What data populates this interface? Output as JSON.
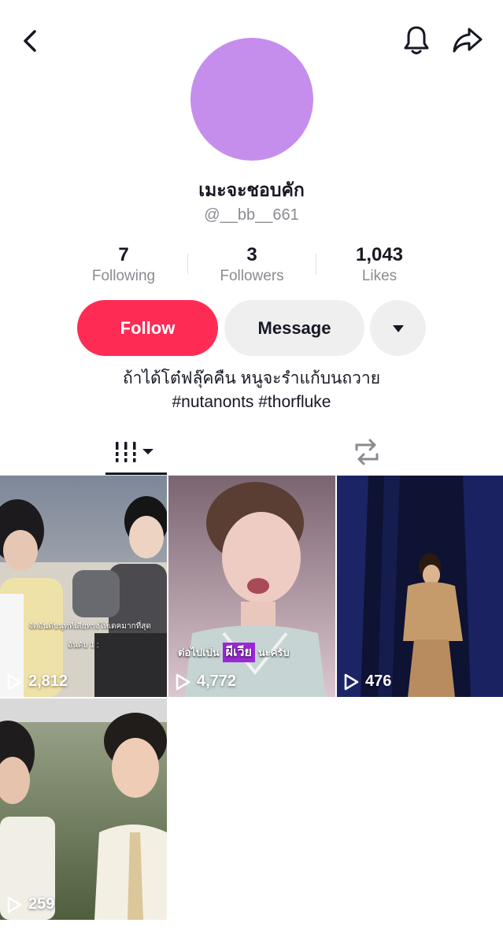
{
  "header": {
    "back_icon": "chevron-left-icon",
    "bell_icon": "bell-icon",
    "share_icon": "share-arrow-icon"
  },
  "profile": {
    "avatar_color": "#c58eed",
    "display_name": "เมะจะชอบคัก",
    "username": "@__bb__661"
  },
  "stats": [
    {
      "value": "7",
      "label": "Following"
    },
    {
      "value": "3",
      "label": "Followers"
    },
    {
      "value": "1,043",
      "label": "Likes"
    }
  ],
  "actions": {
    "follow_label": "Follow",
    "message_label": "Message",
    "more_icon": "caret-down-icon"
  },
  "bio": {
    "line1": "ถ้าได้โต๋ฟลุ๊คคืน หนูจะรำแก้บนถวาย",
    "line2": "#nutanonts #thorfluke"
  },
  "tabs": {
    "videos_icon": "grid-videos-icon",
    "reposts_icon": "repost-icon"
  },
  "videos": [
    {
      "views": "2,812",
      "caption_top": "จัดอันดับนุทที่เสียทรงให้เดคมากที่สุด",
      "caption_bottom": "อันดับ 1 :"
    },
    {
      "views": "4,772",
      "caption_a": "ต่อไปเป็น",
      "caption_b": "ผีเวีย",
      "caption_c": "นะครับ"
    },
    {
      "views": "476"
    },
    {
      "views": "259"
    }
  ],
  "colors": {
    "accent": "#fe2c55",
    "secondary_button": "#efeff0",
    "muted_text": "#8a8b91"
  }
}
